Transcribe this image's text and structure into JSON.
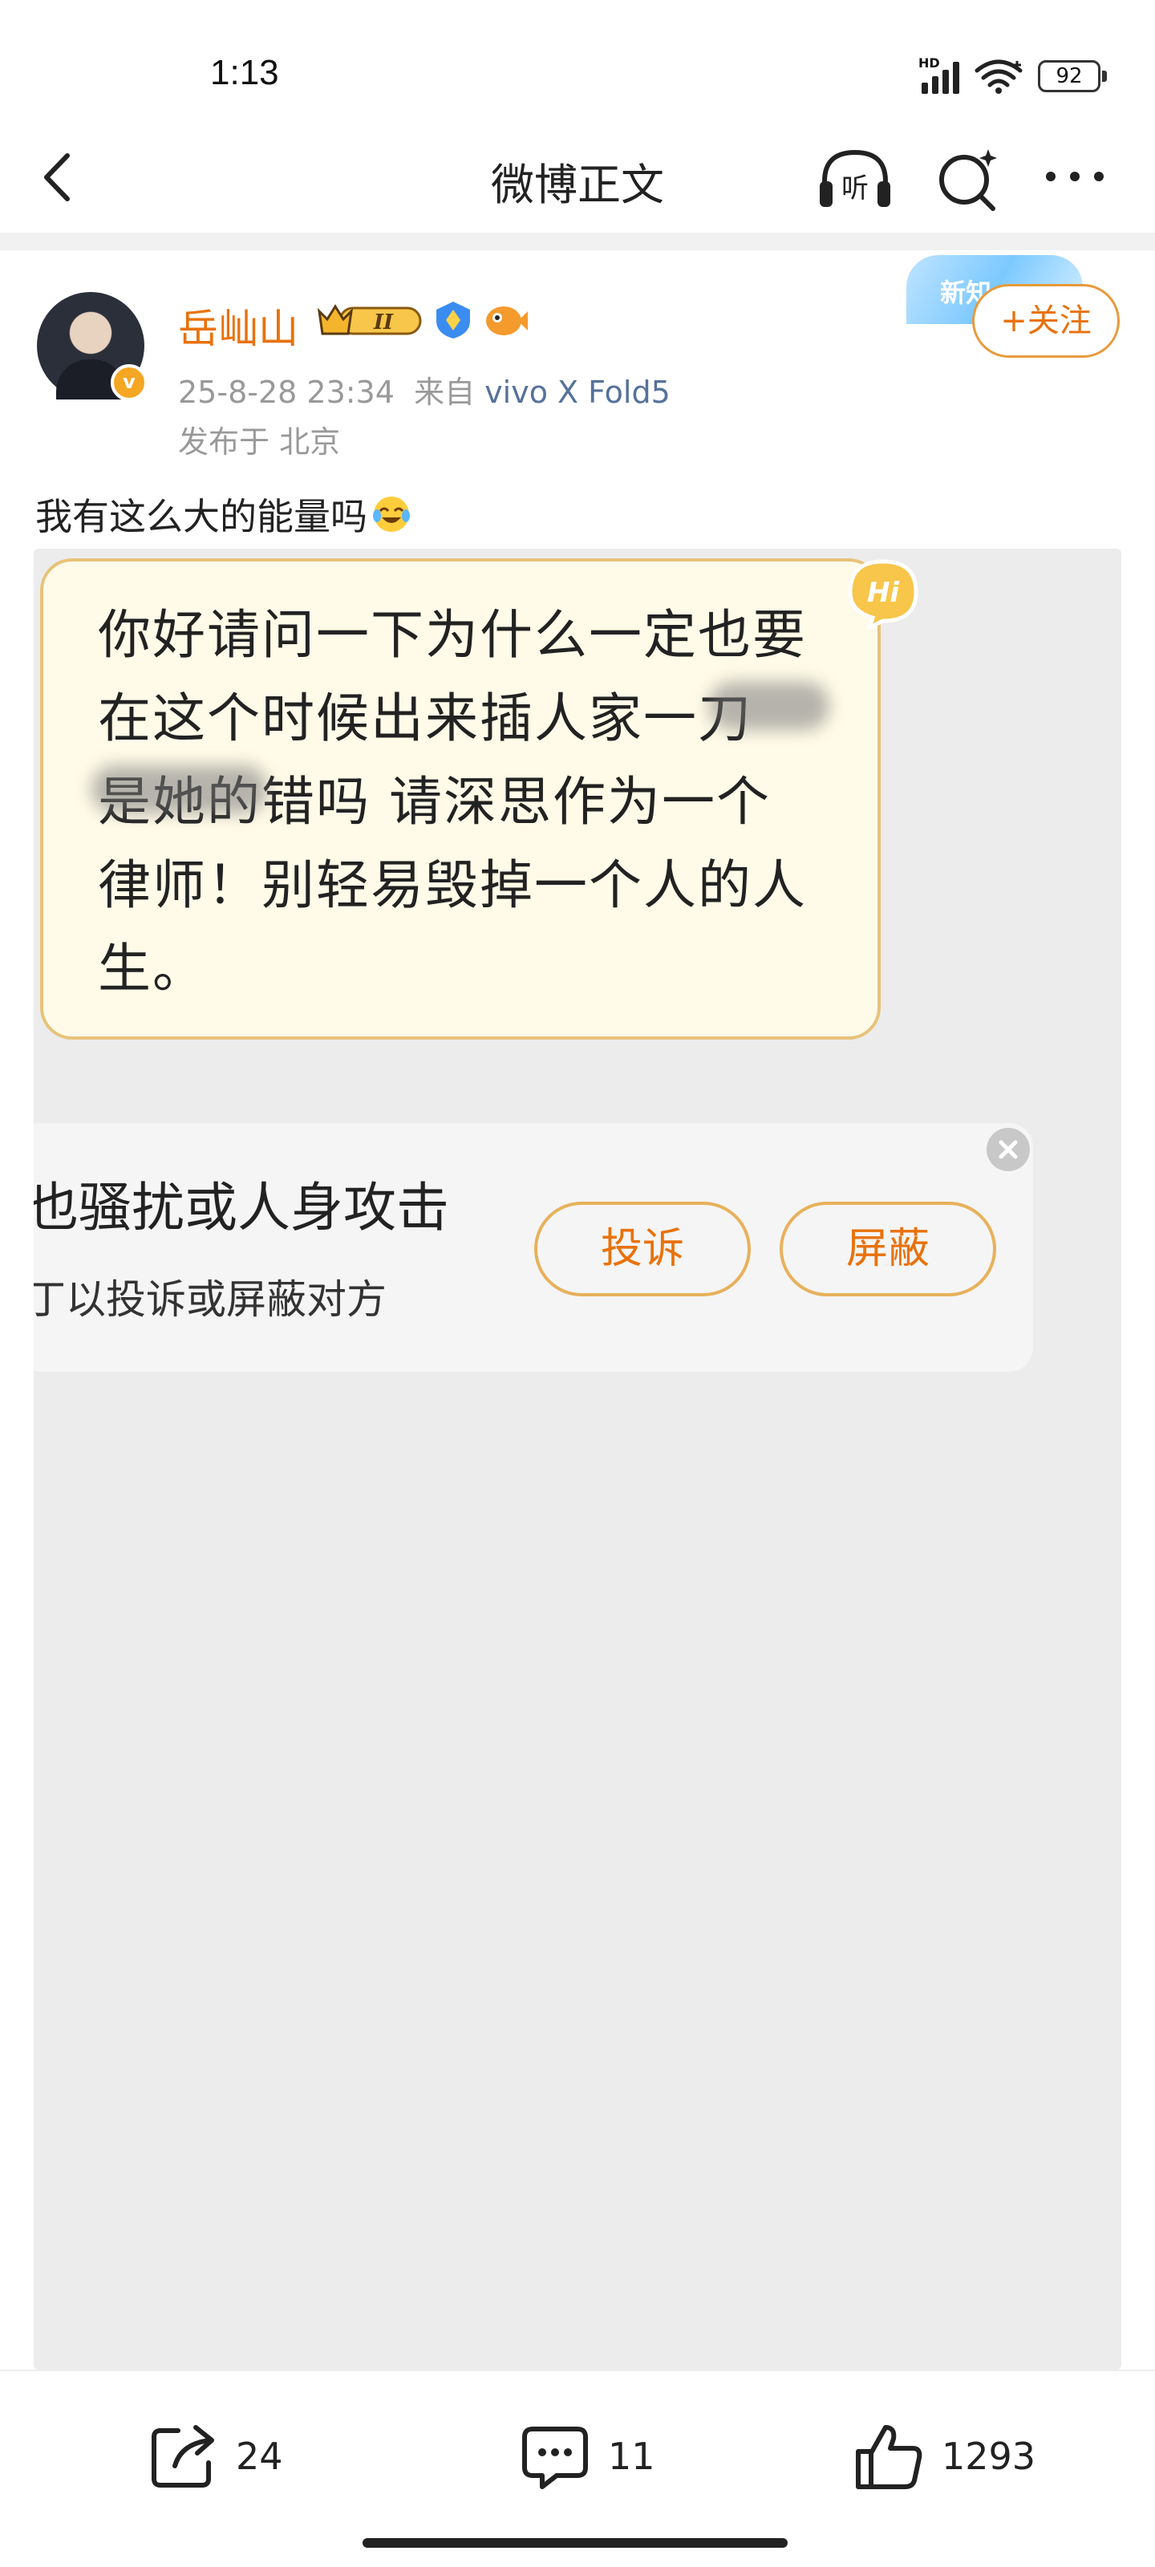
{
  "status_bar": {
    "time": "1:13",
    "network": "HD",
    "battery": "92"
  },
  "nav": {
    "title": "微博正文",
    "listen_label": "听"
  },
  "post": {
    "author": "岳屾山",
    "level_badge": "II",
    "timestamp": "25-8-28 23:34",
    "source_prefix": "来自",
    "device": "vivo X Fold5",
    "location": "发布于 北京",
    "text": "我有这么大的能量吗",
    "follow_label": "+关注",
    "promo_badge": "新知"
  },
  "image": {
    "message_text": "你好请问一下为什么一定也要在这个时候出来插人家一刀 是她的错吗 请深思作为一个律师！别轻易毁掉一个人的人生。",
    "hi_badge": "Hi",
    "warning_title": "也骚扰或人身攻击",
    "warning_sub": "丁以投诉或屏蔽对方",
    "report_label": "投诉",
    "block_label": "屏蔽"
  },
  "actions": {
    "share_count": "24",
    "comment_count": "11",
    "like_count": "1293"
  },
  "colors": {
    "accent": "#e8720c",
    "link": "#56729a",
    "bubble_bg": "#fffbe8"
  }
}
